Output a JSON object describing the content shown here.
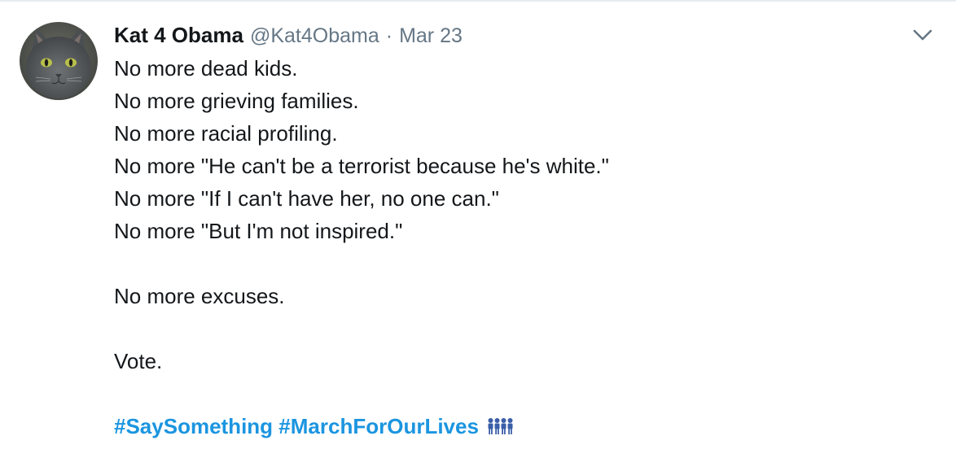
{
  "tweet": {
    "display_name": "Kat 4 Obama",
    "handle": "@Kat4Obama",
    "separator": "·",
    "date": "Mar 23",
    "lines": [
      "No more dead kids.",
      "No more grieving families.",
      "No more racial profiling.",
      "No more \"He can't be a terrorist because he's white.\"",
      "No more \"If I can't have her, no one can.\"",
      "No more \"But I'm not inspired.\""
    ],
    "excuses_line": "No more excuses.",
    "vote_line": "Vote.",
    "hashtags": [
      "#SaySomething",
      "#MarchForOurLives"
    ],
    "emoji": "people-marching-icon"
  },
  "colors": {
    "text": "#14171a",
    "secondary": "#657786",
    "link": "#1b95e0",
    "divider": "#e6ecf0"
  },
  "icons": {
    "avatar": "gray-cat-avatar",
    "menu": "chevron-down-icon"
  }
}
